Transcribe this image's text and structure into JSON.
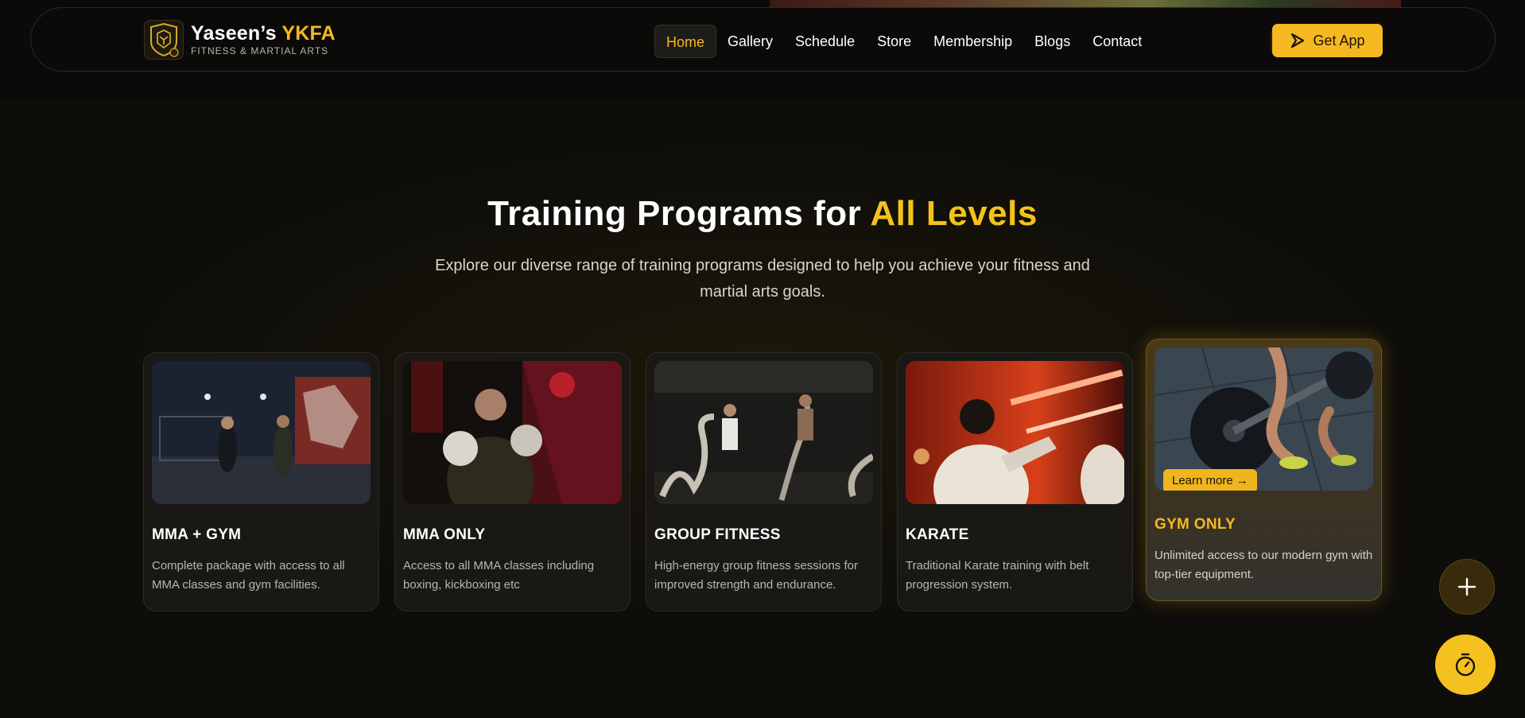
{
  "brand": {
    "name_main": "Yaseen’s",
    "name_accent": "YKFA",
    "tagline": "FITNESS & MARTIAL ARTS",
    "logo_icon": "ykfa-shield-logo"
  },
  "nav": {
    "links": [
      {
        "label": "Home",
        "active": true
      },
      {
        "label": "Gallery"
      },
      {
        "label": "Schedule"
      },
      {
        "label": "Store"
      },
      {
        "label": "Membership"
      },
      {
        "label": "Blogs"
      },
      {
        "label": "Contact"
      }
    ],
    "cta_label": "Get App",
    "cta_icon": "chevron-arrow-icon"
  },
  "section": {
    "title_main": "Training Programs for",
    "title_accent": "All Levels",
    "subtitle": "Explore our diverse range of training programs designed to help you achieve your fitness and martial arts goals."
  },
  "programs": [
    {
      "title": "MMA + GYM",
      "description": "Complete package with access to all MMA classes and gym facilities."
    },
    {
      "title": "MMA ONLY",
      "description": "Access to all MMA classes including boxing, kickboxing etc"
    },
    {
      "title": "GROUP FITNESS",
      "description": "High-energy group fitness sessions for improved strength and endurance."
    },
    {
      "title": "KARATE",
      "description": "Traditional Karate training with belt progression system."
    },
    {
      "title": "GYM ONLY",
      "description": "Unlimited access to our modern gym with top-tier equipment.",
      "featured": true,
      "cta_label": "Learn more →"
    }
  ],
  "fabs": {
    "plus_icon": "plus-icon",
    "timer_icon": "stopwatch-icon"
  },
  "colors": {
    "accent": "#f5b820",
    "background": "#0b0a08",
    "card": "#191815"
  }
}
